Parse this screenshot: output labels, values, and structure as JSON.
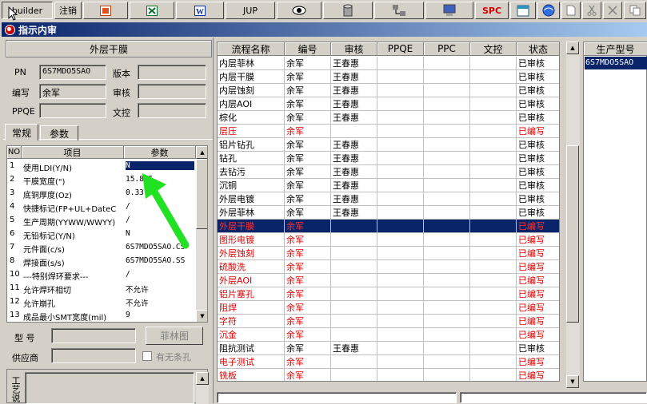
{
  "toolbar": {
    "builder_label": "builder",
    "logout_label": "注销",
    "jup_label": "JUP",
    "spc_label": "SPC"
  },
  "window": {
    "title": "指示内审"
  },
  "header": {
    "section_title": "外层干膜",
    "pn_label": "PN",
    "pn_value": "6S7MDO5SAO",
    "version_label": "版本",
    "version_value": "",
    "author_label": "编写",
    "author_value": "余军",
    "review_label": "审核",
    "review_value": "",
    "ppqe_label": "PPQE",
    "ppqe_value": "",
    "doc_label": "文控",
    "doc_value": ""
  },
  "tabs": [
    {
      "label": "常规"
    },
    {
      "label": "参数"
    }
  ],
  "param_grid": {
    "headers": [
      "NO",
      "项目",
      "参数"
    ],
    "rows": [
      {
        "no": "1",
        "item": "使用LDI(Y/N)",
        "value": "N"
      },
      {
        "no": "2",
        "item": "干膜宽度(\")",
        "value": "15.875"
      },
      {
        "no": "3",
        "item": "底铜厚度(Oz)",
        "value": "0.33"
      },
      {
        "no": "4",
        "item": "快捷标记(FP+UL+DateC",
        "value": "/"
      },
      {
        "no": "5",
        "item": "生产周期(YYWW/WWYY)",
        "value": "/"
      },
      {
        "no": "6",
        "item": "无铅标记(Y/N)",
        "value": "N"
      },
      {
        "no": "7",
        "item": "元件面(c/s)",
        "value": "6S7MDO5SAO.CS"
      },
      {
        "no": "8",
        "item": "焊接面(s/s)",
        "value": "6S7MDO5SAO.SS"
      },
      {
        "no": "10",
        "item": "---特别焊环要求---",
        "value": "/"
      },
      {
        "no": "11",
        "item": "允许焊环相切",
        "value": "不允许"
      },
      {
        "no": "12",
        "item": "允许崩孔",
        "value": "不允许"
      },
      {
        "no": "13",
        "item": "成品最小SMT宽度(mil)",
        "value": "9"
      }
    ]
  },
  "bottom_form": {
    "model_label": "型  号",
    "model_value": "",
    "film_button": "菲林图",
    "supplier_label": "供应商",
    "supplier_value": "",
    "bar_checkbox_label": "有无条孔",
    "craft_label": "工艺说",
    "craft_value": ""
  },
  "process_grid": {
    "headers": [
      "流程名称",
      "编号",
      "审核",
      "PPQE",
      "PPC",
      "文控",
      "状态"
    ],
    "rows": [
      {
        "name": "内层菲林",
        "code": "余军",
        "review": "王春惠",
        "ppqe": "",
        "ppc": "",
        "doc": "",
        "status": "已审核",
        "red": false,
        "selected": false
      },
      {
        "name": "内层干膜",
        "code": "余军",
        "review": "王春惠",
        "ppqe": "",
        "ppc": "",
        "doc": "",
        "status": "已审核",
        "red": false,
        "selected": false
      },
      {
        "name": "内层蚀刻",
        "code": "余军",
        "review": "王春惠",
        "ppqe": "",
        "ppc": "",
        "doc": "",
        "status": "已审核",
        "red": false,
        "selected": false
      },
      {
        "name": "内层AOI",
        "code": "余军",
        "review": "王春惠",
        "ppqe": "",
        "ppc": "",
        "doc": "",
        "status": "已审核",
        "red": false,
        "selected": false
      },
      {
        "name": "棕化",
        "code": "余军",
        "review": "王春惠",
        "ppqe": "",
        "ppc": "",
        "doc": "",
        "status": "已审核",
        "red": false,
        "selected": false
      },
      {
        "name": "层压",
        "code": "余军",
        "review": "",
        "ppqe": "",
        "ppc": "",
        "doc": "",
        "status": "已编写",
        "red": true,
        "selected": false
      },
      {
        "name": "铝片钻孔",
        "code": "余军",
        "review": "王春惠",
        "ppqe": "",
        "ppc": "",
        "doc": "",
        "status": "已审核",
        "red": false,
        "selected": false
      },
      {
        "name": "钻孔",
        "code": "余军",
        "review": "王春惠",
        "ppqe": "",
        "ppc": "",
        "doc": "",
        "status": "已审核",
        "red": false,
        "selected": false
      },
      {
        "name": "去钻污",
        "code": "余军",
        "review": "王春惠",
        "ppqe": "",
        "ppc": "",
        "doc": "",
        "status": "已审核",
        "red": false,
        "selected": false
      },
      {
        "name": "沉铜",
        "code": "余军",
        "review": "王春惠",
        "ppqe": "",
        "ppc": "",
        "doc": "",
        "status": "已审核",
        "red": false,
        "selected": false
      },
      {
        "name": "外层电镀",
        "code": "余军",
        "review": "王春惠",
        "ppqe": "",
        "ppc": "",
        "doc": "",
        "status": "已审核",
        "red": false,
        "selected": false
      },
      {
        "name": "外层菲林",
        "code": "余军",
        "review": "王春惠",
        "ppqe": "",
        "ppc": "",
        "doc": "",
        "status": "已审核",
        "red": false,
        "selected": false
      },
      {
        "name": "外层干膜",
        "code": "余军",
        "review": "",
        "ppqe": "",
        "ppc": "",
        "doc": "",
        "status": "已编写",
        "red": true,
        "selected": true
      },
      {
        "name": "图形电镀",
        "code": "余军",
        "review": "",
        "ppqe": "",
        "ppc": "",
        "doc": "",
        "status": "已编写",
        "red": true,
        "selected": false
      },
      {
        "name": "外层蚀刻",
        "code": "余军",
        "review": "",
        "ppqe": "",
        "ppc": "",
        "doc": "",
        "status": "已编写",
        "red": true,
        "selected": false
      },
      {
        "name": "硫酸洗",
        "code": "余军",
        "review": "",
        "ppqe": "",
        "ppc": "",
        "doc": "",
        "status": "已编写",
        "red": true,
        "selected": false
      },
      {
        "name": "外层AOI",
        "code": "余军",
        "review": "",
        "ppqe": "",
        "ppc": "",
        "doc": "",
        "status": "已编写",
        "red": true,
        "selected": false
      },
      {
        "name": "铝片塞孔",
        "code": "余军",
        "review": "",
        "ppqe": "",
        "ppc": "",
        "doc": "",
        "status": "已编写",
        "red": true,
        "selected": false
      },
      {
        "name": "阻焊",
        "code": "余军",
        "review": "",
        "ppqe": "",
        "ppc": "",
        "doc": "",
        "status": "已编写",
        "red": true,
        "selected": false
      },
      {
        "name": "字符",
        "code": "余军",
        "review": "",
        "ppqe": "",
        "ppc": "",
        "doc": "",
        "status": "已编写",
        "red": true,
        "selected": false
      },
      {
        "name": "沉金",
        "code": "余军",
        "review": "",
        "ppqe": "",
        "ppc": "",
        "doc": "",
        "status": "已编写",
        "red": true,
        "selected": false
      },
      {
        "name": "阻抗测试",
        "code": "余军",
        "review": "王春惠",
        "ppqe": "",
        "ppc": "",
        "doc": "",
        "status": "已审核",
        "red": false,
        "selected": false
      },
      {
        "name": "电子测试",
        "code": "余军",
        "review": "",
        "ppqe": "",
        "ppc": "",
        "doc": "",
        "status": "已编写",
        "red": true,
        "selected": false
      },
      {
        "name": "铣板",
        "code": "余军",
        "review": "",
        "ppqe": "",
        "ppc": "",
        "doc": "",
        "status": "已编写",
        "red": true,
        "selected": false
      }
    ]
  },
  "side_grid": {
    "header": "生产型号",
    "items": [
      "6S7MDO5SAO"
    ]
  },
  "colors": {
    "selection": "#0a246a",
    "written_status": "#e00000",
    "annotation_arrow": "#22e022"
  },
  "icons": [
    "ppt-icon",
    "excel-icon",
    "word-icon",
    "eye-icon",
    "database-icon",
    "network-icon",
    "computer-icon",
    "calendar-icon",
    "globe-icon",
    "new-doc-icon",
    "cut-icon",
    "close-icon",
    "copy-icon"
  ]
}
